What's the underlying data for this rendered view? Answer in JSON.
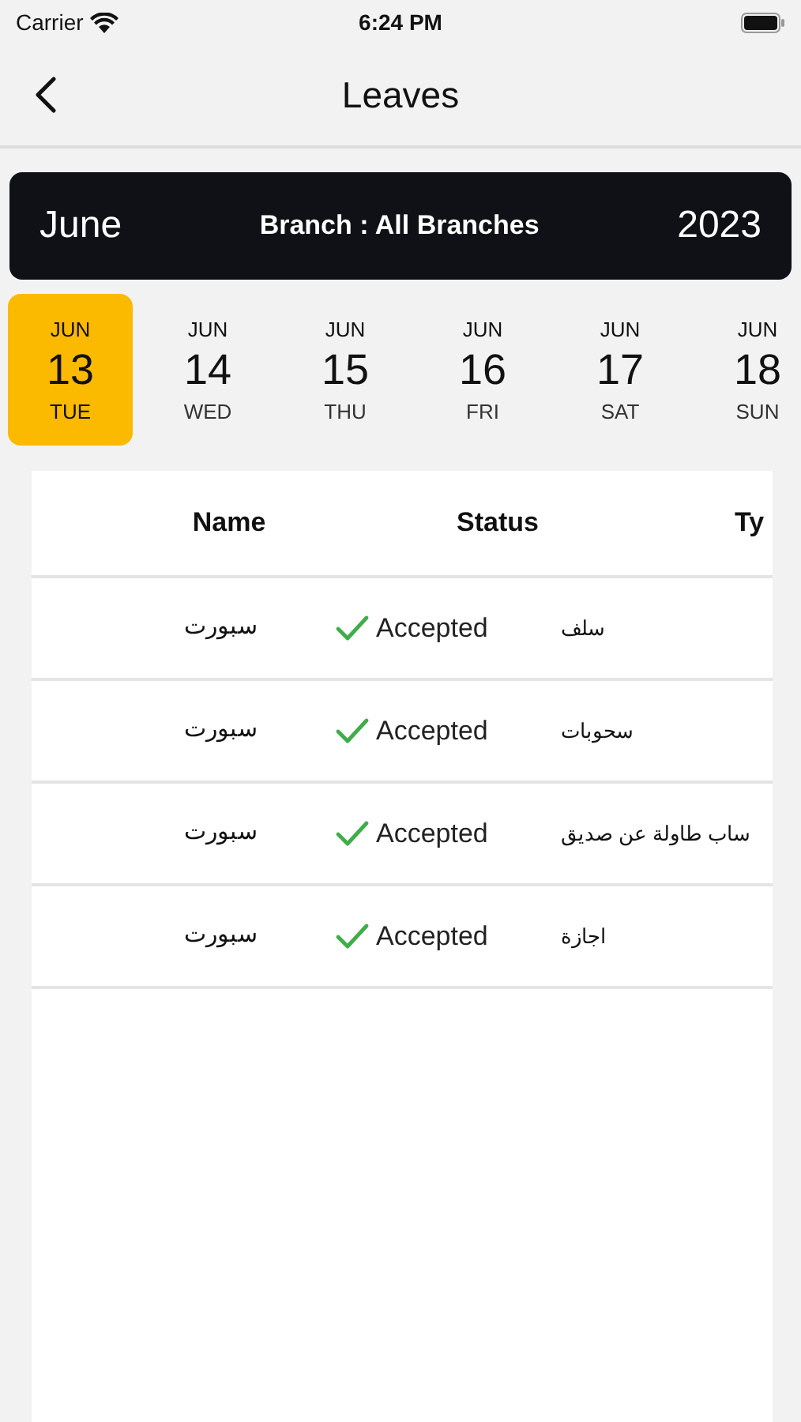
{
  "status_bar": {
    "carrier": "Carrier",
    "time": "6:24 PM"
  },
  "nav": {
    "title": "Leaves"
  },
  "banner": {
    "month": "June",
    "branch": "Branch : All Branches",
    "year": "2023"
  },
  "days": [
    {
      "month": "JUN",
      "day": "13",
      "weekday": "TUE",
      "selected": true
    },
    {
      "month": "JUN",
      "day": "14",
      "weekday": "WED",
      "selected": false
    },
    {
      "month": "JUN",
      "day": "15",
      "weekday": "THU",
      "selected": false
    },
    {
      "month": "JUN",
      "day": "16",
      "weekday": "FRI",
      "selected": false
    },
    {
      "month": "JUN",
      "day": "17",
      "weekday": "SAT",
      "selected": false
    },
    {
      "month": "JUN",
      "day": "18",
      "weekday": "SUN",
      "selected": false
    }
  ],
  "table": {
    "columns": [
      "Name",
      "Status",
      "Ty"
    ],
    "rows": [
      {
        "name": "سبورت",
        "status": "Accepted",
        "kind": "accepted",
        "type": "سلف"
      },
      {
        "name": "سبورت",
        "status": "Accepted",
        "kind": "accepted",
        "type": "سحوبات"
      },
      {
        "name": "سبورت",
        "status": "Accepted",
        "kind": "accepted",
        "type": "ساب طاولة عن صديق"
      },
      {
        "name": "سبورت",
        "status": "Accepted",
        "kind": "accepted",
        "type": "اجازة"
      }
    ]
  }
}
